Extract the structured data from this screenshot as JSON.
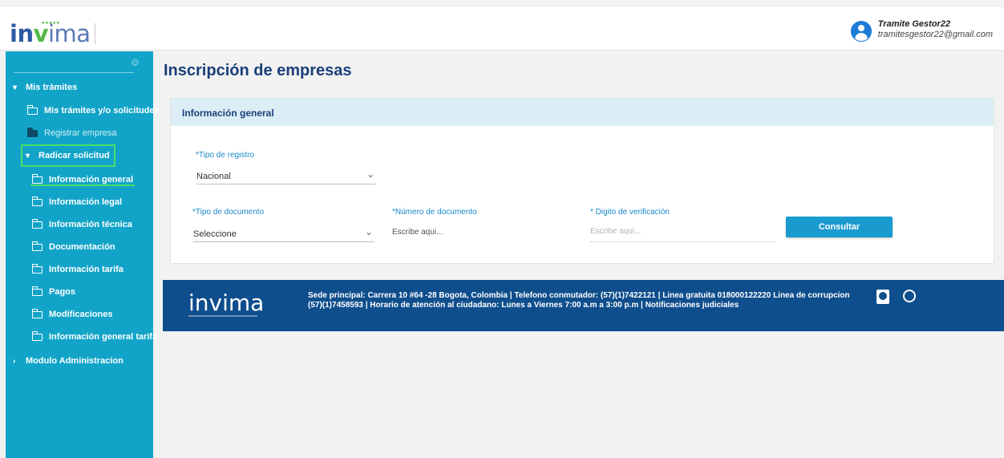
{
  "header": {
    "logo_text_in": "in",
    "logo_text_v": "v",
    "logo_text_ima": "ima",
    "user_name": "Tramite Gestor22",
    "user_email": "tramitesgestor22@gmail.com"
  },
  "sidebar": {
    "sections": [
      {
        "label": "Mis trámites"
      },
      {
        "label": "Radicar solicitud"
      },
      {
        "label": "Modulo Administracion"
      }
    ],
    "mis_tramites_items": [
      {
        "label": "Mis trámites y/o solicitudes"
      },
      {
        "label": "Registrar empresa"
      }
    ],
    "radicar_items": [
      {
        "label": "Información general"
      },
      {
        "label": "Información legal"
      },
      {
        "label": "Información técnica"
      },
      {
        "label": "Documentación"
      },
      {
        "label": "Información tarifa"
      },
      {
        "label": "Pagos"
      },
      {
        "label": "Modificaciones"
      },
      {
        "label": "Información general tarifa"
      }
    ]
  },
  "main": {
    "page_title": "Inscripción de empresas",
    "card_title": "Información general",
    "tipo_registro": {
      "label": "*Tipo de registro",
      "value": "Nacional"
    },
    "tipo_documento": {
      "label": "*Tipo de documento",
      "value": "Seleccione"
    },
    "numero_documento": {
      "label": "*Número de documento",
      "placeholder": "Escribe aqui..."
    },
    "digito_verificacion": {
      "label": "* Digito de verificación",
      "placeholder": "Escribe aqui..."
    },
    "consultar_label": "Consultar"
  },
  "footer": {
    "logo_text_in": "in",
    "logo_text_v": "v",
    "logo_text_ima": "ima",
    "line1": "Sede principal: Carrera 10 #64 -28 Bogota, Colombia | Telefono conmutador: (57)(1)7422121 | Linea gratuita 018000122220 Linea de corrupcion",
    "line2": "(57)(1)7458593 | Horario de atención al ciudadano: Lunes a Viernes 7:00 a.m a 3:00 p.m | Notificaciones judiciales"
  },
  "colors": {
    "sidebar": "#12a4c8",
    "footer": "#0f4e8c",
    "title": "#1b3f78",
    "highlight": "#46e06a",
    "button": "#1a9bd0"
  }
}
